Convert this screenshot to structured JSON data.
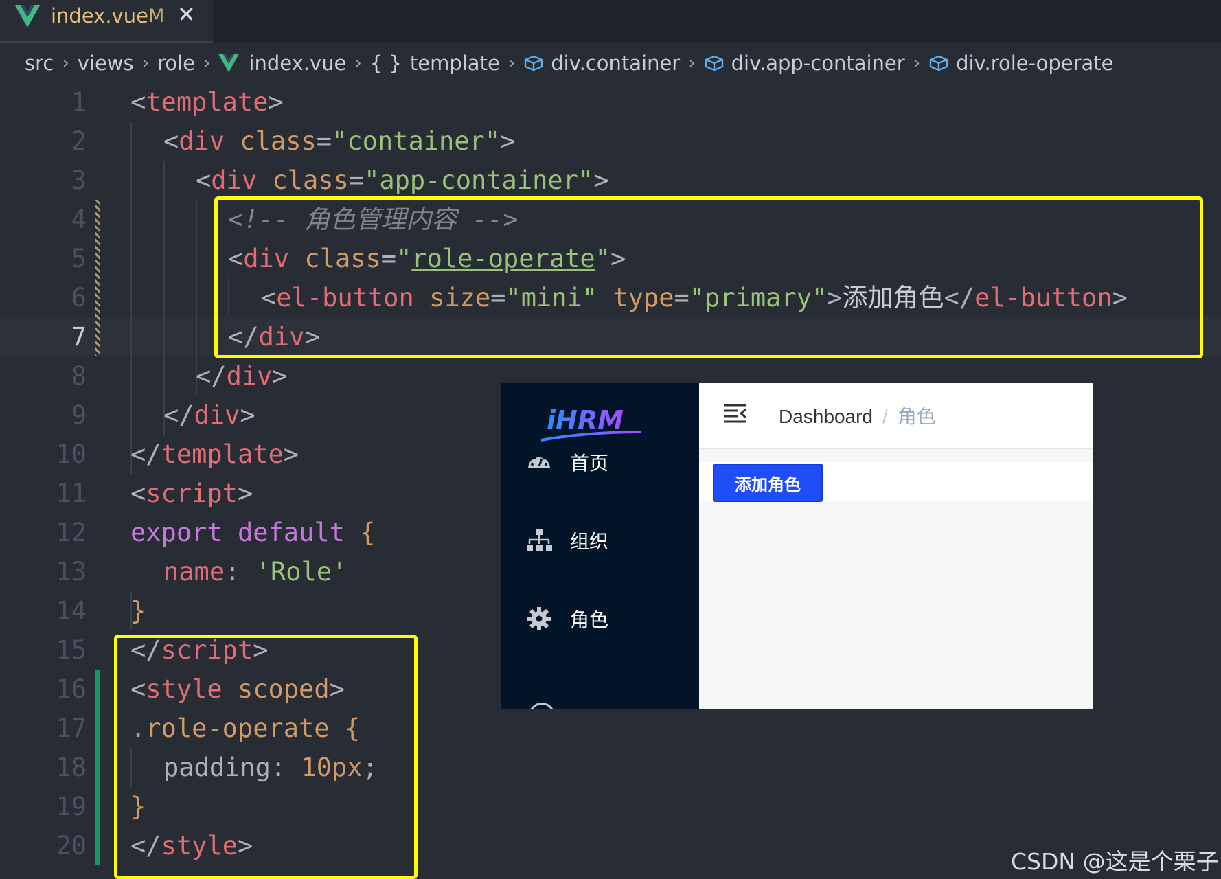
{
  "tab": {
    "filename": "index.vue",
    "status": "M",
    "close": "✕"
  },
  "breadcrumb": {
    "src": "src",
    "views": "views",
    "role": "role",
    "file": "index.vue",
    "braces": "{ }",
    "template": "template",
    "c1": "div.container",
    "c2": "div.app-container",
    "c3": "div.role-operate",
    "sep": "›"
  },
  "editor": {
    "active_line": 7,
    "lines": [
      {
        "n": "1"
      },
      {
        "n": "2"
      },
      {
        "n": "3"
      },
      {
        "n": "4"
      },
      {
        "n": "5"
      },
      {
        "n": "6"
      },
      {
        "n": "7"
      },
      {
        "n": "8"
      },
      {
        "n": "9"
      },
      {
        "n": "10"
      },
      {
        "n": "11"
      },
      {
        "n": "12"
      },
      {
        "n": "13"
      },
      {
        "n": "14"
      },
      {
        "n": "15"
      },
      {
        "n": "16"
      },
      {
        "n": "17"
      },
      {
        "n": "18"
      },
      {
        "n": "19"
      },
      {
        "n": "20"
      }
    ],
    "tokens": {
      "l1": [
        "<",
        "template",
        ">"
      ],
      "l2": [
        "<",
        "div",
        " ",
        "class",
        "=",
        "\"container\"",
        ">"
      ],
      "l3": [
        "<",
        "div",
        " ",
        "class",
        "=",
        "\"app-container\"",
        ">"
      ],
      "l4": "<!-- 角色管理内容 -->",
      "l5": [
        "<",
        "div",
        " ",
        "class",
        "=",
        "\"",
        "role-operate",
        "\"",
        ">"
      ],
      "l6": [
        "<",
        "el-button",
        " ",
        "size",
        "=",
        "\"mini\"",
        " ",
        "type",
        "=",
        "\"primary\"",
        ">",
        "添加角色",
        "</",
        "el-button",
        ">"
      ],
      "l7": [
        "</",
        "div",
        ">"
      ],
      "l8": [
        "</",
        "div",
        ">"
      ],
      "l9": [
        "</",
        "div",
        ">"
      ],
      "l10": [
        "</",
        "template",
        ">"
      ],
      "l11": [
        "<",
        "script",
        ">"
      ],
      "l12": [
        "export",
        " ",
        "default",
        " ",
        "{"
      ],
      "l13": [
        "name",
        ": ",
        "'Role'"
      ],
      "l14": [
        "}"
      ],
      "l15": [
        "</",
        "script",
        ">"
      ],
      "l16": [
        "<",
        "style",
        " ",
        "scoped",
        ">"
      ],
      "l17": [
        ".role-operate",
        " ",
        "{"
      ],
      "l18": [
        "padding",
        ": ",
        "10px",
        ";"
      ],
      "l19": [
        "}"
      ],
      "l20": [
        "</",
        "style",
        ">"
      ]
    }
  },
  "preview": {
    "logo_text": "iHRM",
    "menu": [
      {
        "label": "首页",
        "icon": "dashboard-icon"
      },
      {
        "label": "组织",
        "icon": "org-tree-icon"
      },
      {
        "label": "角色",
        "icon": "gear-icon"
      }
    ],
    "breadcrumb_home": "Dashboard",
    "breadcrumb_sep": "/",
    "breadcrumb_current": "角色",
    "add_button": "添加角色"
  },
  "watermark": "CSDN @这是个栗子",
  "colors": {
    "highlight": "#ffff00",
    "tag": "#e06c75",
    "attr": "#d19a66",
    "string": "#98c379",
    "keyword": "#c678dd",
    "button": "#1f4ef7"
  }
}
